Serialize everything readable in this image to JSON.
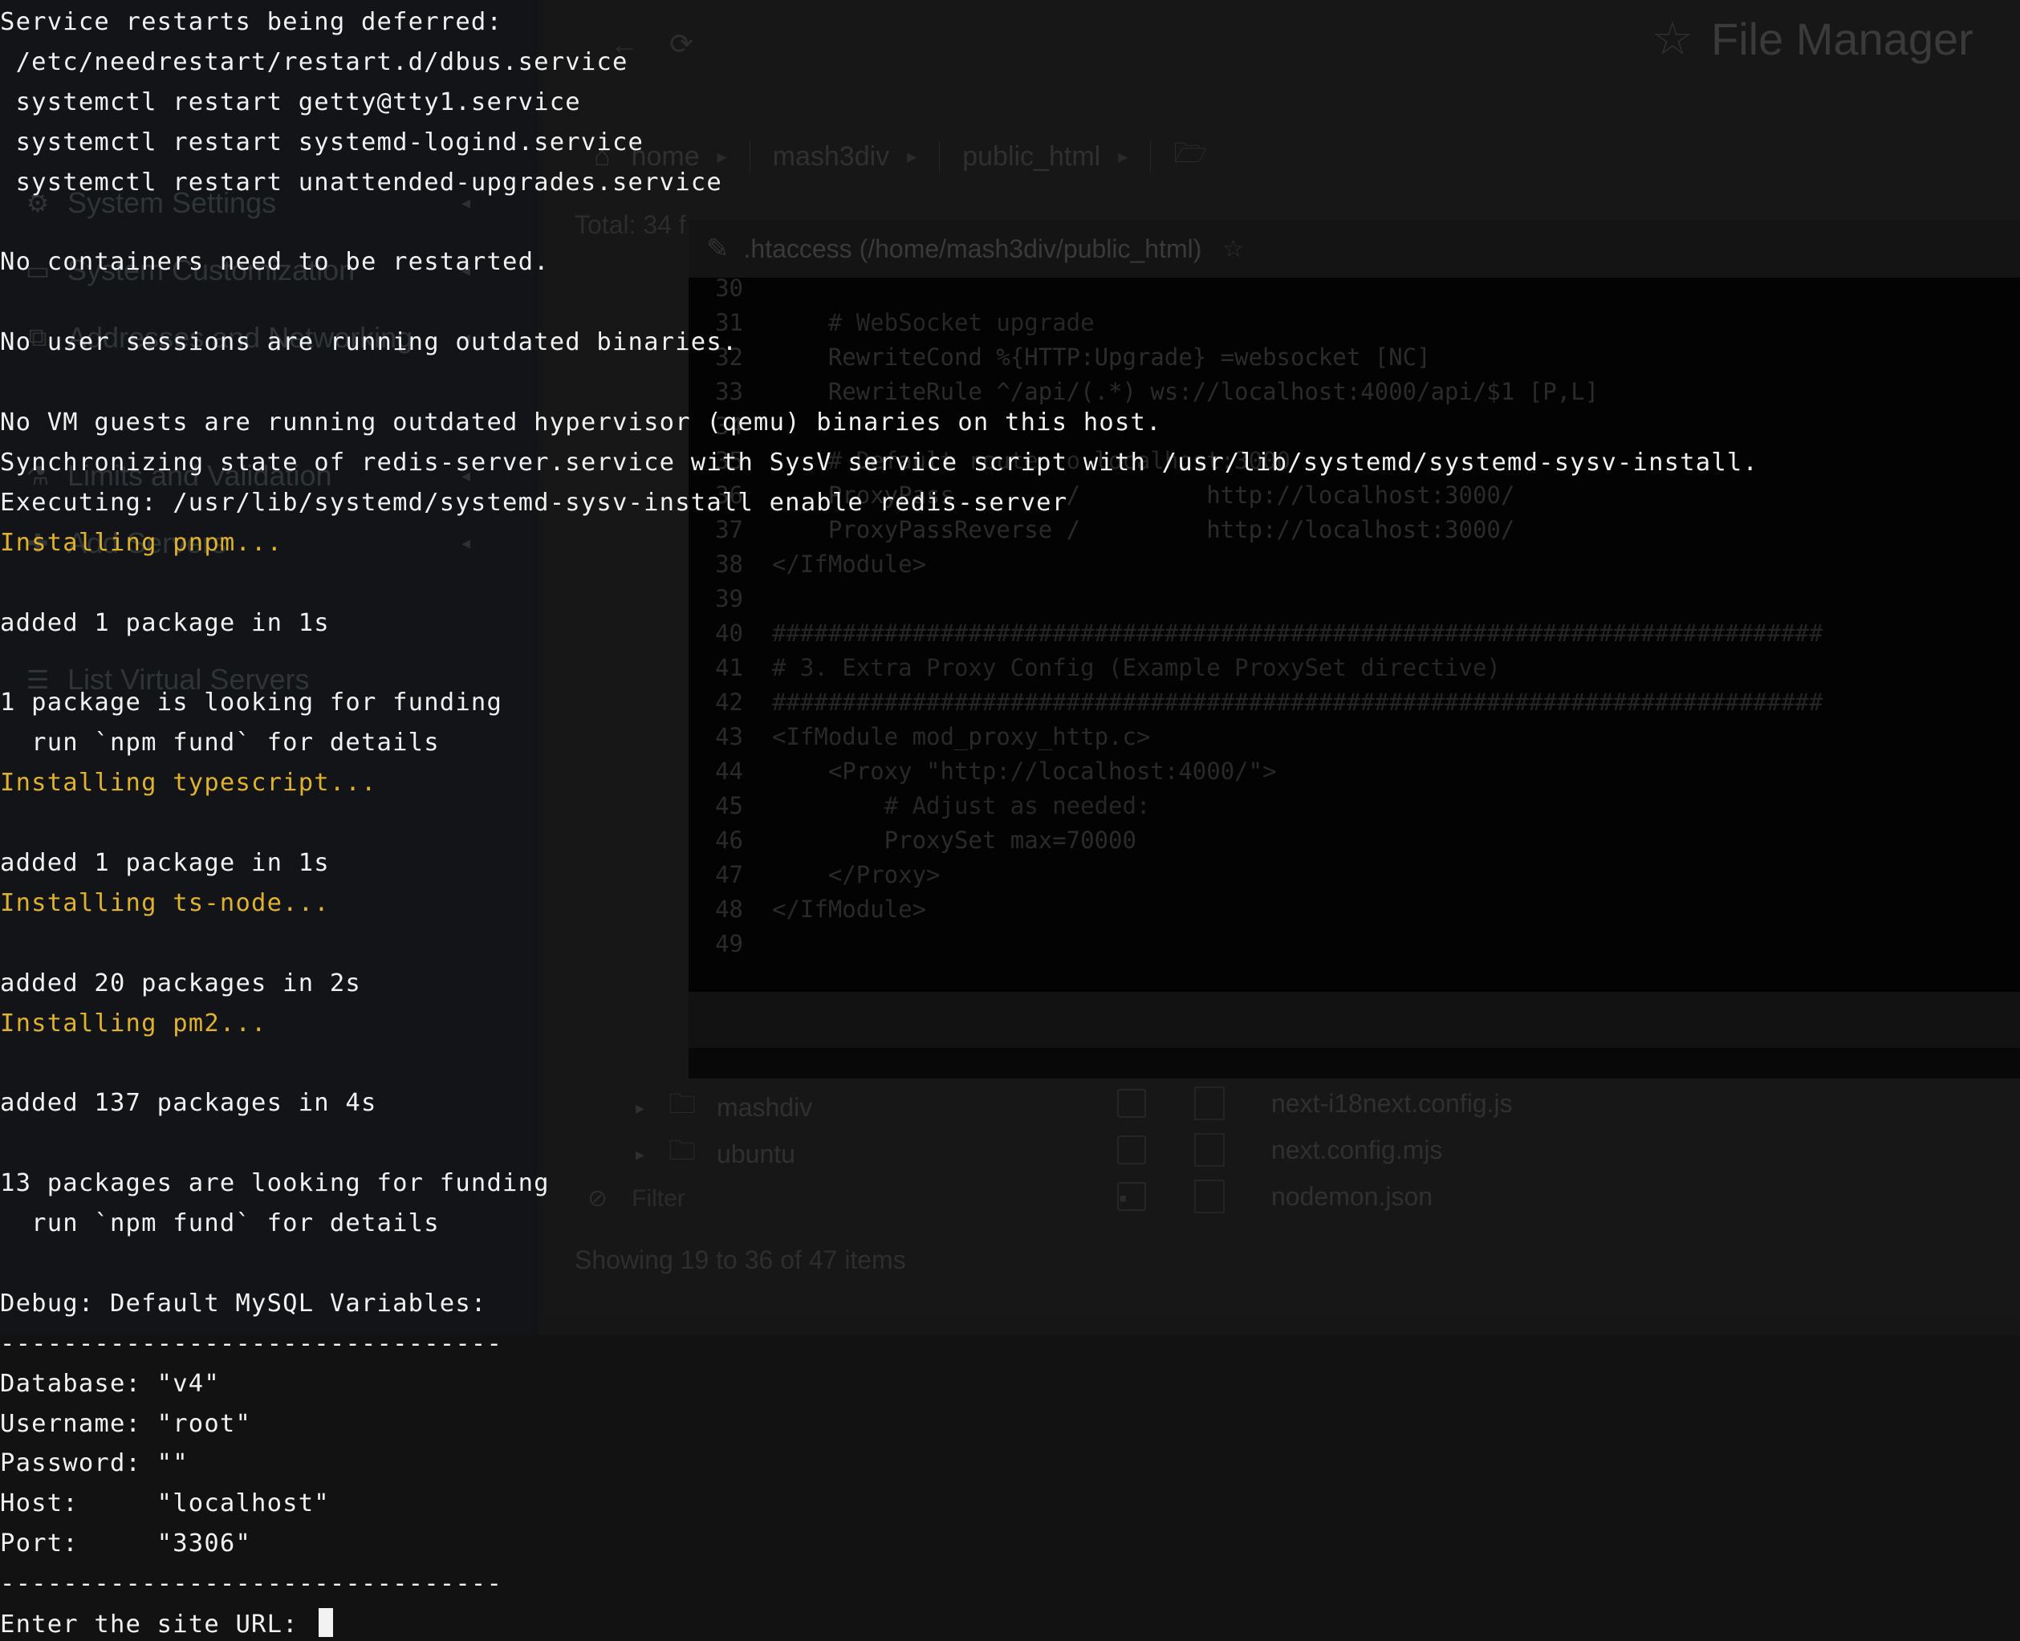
{
  "background_app": {
    "title": "File Manager",
    "sidebar": [
      {
        "label": "System Settings",
        "icon": "gear-icon"
      },
      {
        "label": "System Customization",
        "icon": "monitor-icon"
      },
      {
        "label": "Addresses and Networking",
        "icon": "network-icon"
      },
      {
        "label": "Limits and Validation",
        "icon": "flask-icon"
      },
      {
        "label": "Add Servers",
        "icon": "plus-icon"
      },
      {
        "label": "List Virtual Servers",
        "icon": "list-icon"
      }
    ],
    "breadcrumb": [
      "home",
      "mash3div",
      "public_html"
    ],
    "total_text": "Total: 34 f",
    "editor": {
      "title": ".htaccess (/home/mash3div/public_html)",
      "lines": [
        {
          "n": "30",
          "t": ""
        },
        {
          "n": "31",
          "t": "    # WebSocket upgrade"
        },
        {
          "n": "32",
          "t": "    RewriteCond %{HTTP:Upgrade} =websocket [NC]"
        },
        {
          "n": "33",
          "t": "    RewriteRule ^/api/(.*) ws://localhost:4000/api/$1 [P,L]"
        },
        {
          "n": "34",
          "t": ""
        },
        {
          "n": "35",
          "t": "    # Default route to localhost:3000"
        },
        {
          "n": "36",
          "t": "    ProxyPass        /         http://localhost:3000/"
        },
        {
          "n": "37",
          "t": "    ProxyPassReverse /         http://localhost:3000/"
        },
        {
          "n": "38",
          "t": "</IfModule>"
        },
        {
          "n": "39",
          "t": ""
        },
        {
          "n": "40",
          "t": "###########################################################################"
        },
        {
          "n": "41",
          "t": "# 3. Extra Proxy Config (Example ProxySet directive)"
        },
        {
          "n": "42",
          "t": "###########################################################################"
        },
        {
          "n": "43",
          "t": "<IfModule mod_proxy_http.c>"
        },
        {
          "n": "44",
          "t": "    <Proxy \"http://localhost:4000/\">"
        },
        {
          "n": "45",
          "t": "        # Adjust as needed:"
        },
        {
          "n": "46",
          "t": "        ProxySet max=70000"
        },
        {
          "n": "47",
          "t": "    </Proxy>"
        },
        {
          "n": "48",
          "t": "</IfModule>"
        },
        {
          "n": "49",
          "t": ""
        }
      ]
    },
    "tree": [
      "mashdiv",
      "ubuntu"
    ],
    "files": [
      "next-i18next.config.js",
      "next.config.mjs",
      "nodemon.json"
    ],
    "filter_placeholder": "Filter",
    "showing_text": "Showing 19 to 36 of 47 items"
  },
  "terminal": {
    "text_color": "#f1f1f1",
    "highlight_color": "#e0b22a",
    "lines": [
      {
        "text": "Service restarts being deferred:",
        "color": "white"
      },
      {
        "text": " /etc/needrestart/restart.d/dbus.service",
        "color": "white"
      },
      {
        "text": " systemctl restart getty@tty1.service",
        "color": "white"
      },
      {
        "text": " systemctl restart systemd-logind.service",
        "color": "white"
      },
      {
        "text": " systemctl restart unattended-upgrades.service",
        "color": "white"
      },
      {
        "text": "",
        "color": "white"
      },
      {
        "text": "No containers need to be restarted.",
        "color": "white"
      },
      {
        "text": "",
        "color": "white"
      },
      {
        "text": "No user sessions are running outdated binaries.",
        "color": "white"
      },
      {
        "text": "",
        "color": "white"
      },
      {
        "text": "No VM guests are running outdated hypervisor (qemu) binaries on this host.",
        "color": "white"
      },
      {
        "text": "Synchronizing state of redis-server.service with SysV service script with /usr/lib/systemd/systemd-sysv-install.",
        "color": "white"
      },
      {
        "text": "Executing: /usr/lib/systemd/systemd-sysv-install enable redis-server",
        "color": "white"
      },
      {
        "text": "Installing pnpm...",
        "color": "yellow"
      },
      {
        "text": "",
        "color": "white"
      },
      {
        "text": "added 1 package in 1s",
        "color": "white"
      },
      {
        "text": "",
        "color": "white"
      },
      {
        "text": "1 package is looking for funding",
        "color": "white"
      },
      {
        "text": "  run `npm fund` for details",
        "color": "white"
      },
      {
        "text": "Installing typescript...",
        "color": "yellow"
      },
      {
        "text": "",
        "color": "white"
      },
      {
        "text": "added 1 package in 1s",
        "color": "white"
      },
      {
        "text": "Installing ts-node...",
        "color": "yellow"
      },
      {
        "text": "",
        "color": "white"
      },
      {
        "text": "added 20 packages in 2s",
        "color": "white"
      },
      {
        "text": "Installing pm2...",
        "color": "yellow"
      },
      {
        "text": "",
        "color": "white"
      },
      {
        "text": "added 137 packages in 4s",
        "color": "white"
      },
      {
        "text": "",
        "color": "white"
      },
      {
        "text": "13 packages are looking for funding",
        "color": "white"
      },
      {
        "text": "  run `npm fund` for details",
        "color": "white"
      },
      {
        "text": "",
        "color": "white"
      },
      {
        "text": "Debug: Default MySQL Variables:",
        "color": "white"
      },
      {
        "text": "--------------------------------",
        "color": "white"
      },
      {
        "text": "Database: \"v4\"",
        "color": "white"
      },
      {
        "text": "Username: \"root\"",
        "color": "white"
      },
      {
        "text": "Password: \"\"",
        "color": "white"
      },
      {
        "text": "Host:     \"localhost\"",
        "color": "white"
      },
      {
        "text": "Port:     \"3306\"",
        "color": "white"
      },
      {
        "text": "--------------------------------",
        "color": "white"
      }
    ],
    "prompt": "Enter the site URL: "
  }
}
